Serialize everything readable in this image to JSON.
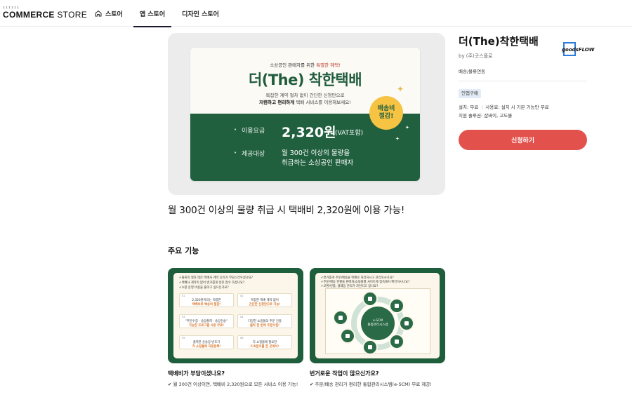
{
  "header": {
    "logo_dots": "ıııııı",
    "logo_bold": "COMMERCE",
    "logo_light": "STORE",
    "nav": [
      {
        "label": "스토어",
        "icon": "home-icon"
      },
      {
        "label": "앱 스토어",
        "active": true
      },
      {
        "label": "디자인 스토어"
      }
    ]
  },
  "banner": {
    "subtitle_prefix": "소상공인 판매자를 위한 ",
    "subtitle_highlight": "특별한 혜택!",
    "title": "더(The) 착한택배",
    "desc1": "복잡한 계약 절차 없이 간단한 신청만으로",
    "desc2_bold": "저렴하고 편리하게",
    "desc2_rest": " 택배 서비스를 이용해보세요!",
    "price_label": "이용요금",
    "price": "2,320원",
    "price_vat": "(VAT포함)",
    "target_label": "제공대상",
    "target_line1": "월 300건 이상의 물량을",
    "target_line2": "취급하는 소상공인 판매자",
    "badge_line1": "배송비",
    "badge_line2": "절감!"
  },
  "headline": "월 300건 이상의 물량 취급 시 택배비 2,320원에 이용 가능!",
  "product": {
    "title": "더(The)착한택배",
    "by": "by (주)굿스플로",
    "vendor_logo_text": "goodsFLOW",
    "category": "배송/물류연동",
    "tag": "인앱구매",
    "install": "설치: 무료",
    "usage": "사용료: 설치 시 기본 기능만 무료",
    "support": "지원 솔루션: 샵바이, 고도몰",
    "apply_label": "신청하기"
  },
  "features": {
    "title": "주요 기능",
    "cards": [
      {
        "caption_title": "택배비가 부담이셨나요?",
        "caption_desc": "✔ 월 300건 이상이면, 택배비 2,320원으로 모든 서비스 이용 가능!",
        "questions": [
          "물류의 절차 많은 택배사 계약 단가가 부담스러우셨나요?",
          "택배사 계약이 없어 번거롭게 방문 접수 하셨나요?",
          "소량 운영 비용을 줄이고 싶으신가요?"
        ],
        "boxes": [
          {
            "n": "01",
            "t": "2,320원이라는 저렴한",
            "b": "택배비로 배송비 절감!"
          },
          {
            "n": "02",
            "t": "복잡한 택배 계약 없이",
            "b": "간단한 신청만으로 가능!"
          },
          {
            "n": "03",
            "t": "\"주문수집 - 송장출력 - 송장전송\"",
            "b": "가능한 프로그램 사용 무료!"
          },
          {
            "n": "04",
            "t": "다양한 쇼핑몰의 주문 건을",
            "b": "클릭 한 번에 주문수집!"
          },
          {
            "n": "05",
            "t": "출력한 운송장 번호가",
            "b": "각 쇼핑몰에 자동등록!"
          },
          {
            "n": "06",
            "t": "각 쇼핑몰에 필요한",
            "b": "C/S문의를 한 곳에서!"
          }
        ]
      },
      {
        "caption_title": "번거로운 작업이 많으신가요?",
        "caption_desc": "✔ 주문/배송 관리가 편리한 통합관리시스템(e-SCM) 무료 제공!",
        "questions": [
          "번거롭게 주문/배송을 택배로 처리하시고 관리하시나요?",
          "주문/배송 현황을 판매처/쇼핑몰별 사이트에 접속해서 확인하시나요?",
          "교환/반품, 클레임 관리가 자연되고 있나요?"
        ],
        "center_line1": "e-SCM",
        "center_line2": "통합관리시스템"
      }
    ]
  }
}
